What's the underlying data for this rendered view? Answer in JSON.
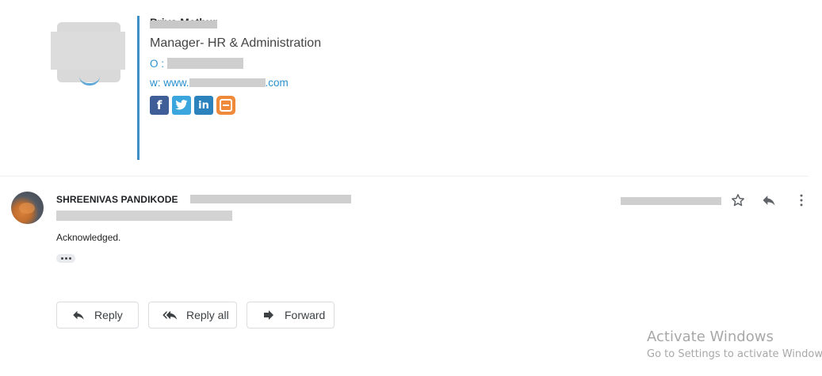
{
  "signature": {
    "name": "Priya Mathur",
    "title": "Manager- HR & Administration",
    "office_prefix": "O :",
    "web_prefix": "w: www.",
    "web_suffix": ".com",
    "social": [
      {
        "icon": "facebook-icon",
        "glyph": "f",
        "color": "#3f5e97"
      },
      {
        "icon": "twitter-icon",
        "glyph": "t",
        "color": "#3aa6dd"
      },
      {
        "icon": "linkedin-icon",
        "glyph": "in",
        "color": "#2c82bd"
      },
      {
        "icon": "blogger-icon",
        "glyph": "",
        "color": "#ef8a3b"
      }
    ],
    "accent_color": "#3d8fc6",
    "link_color": "#2a8fcf"
  },
  "message": {
    "sender_name": "SHREENIVAS PANDIKODE",
    "body": "Acknowledged.",
    "icons": {
      "star": "star-icon",
      "reply": "reply-icon",
      "more": "more-vertical-icon"
    }
  },
  "actions": {
    "reply_label": "Reply",
    "reply_all_label": "Reply all",
    "forward_label": "Forward"
  },
  "watermark": {
    "title": "Activate Windows",
    "subtitle": "Go to Settings to activate Windows."
  }
}
